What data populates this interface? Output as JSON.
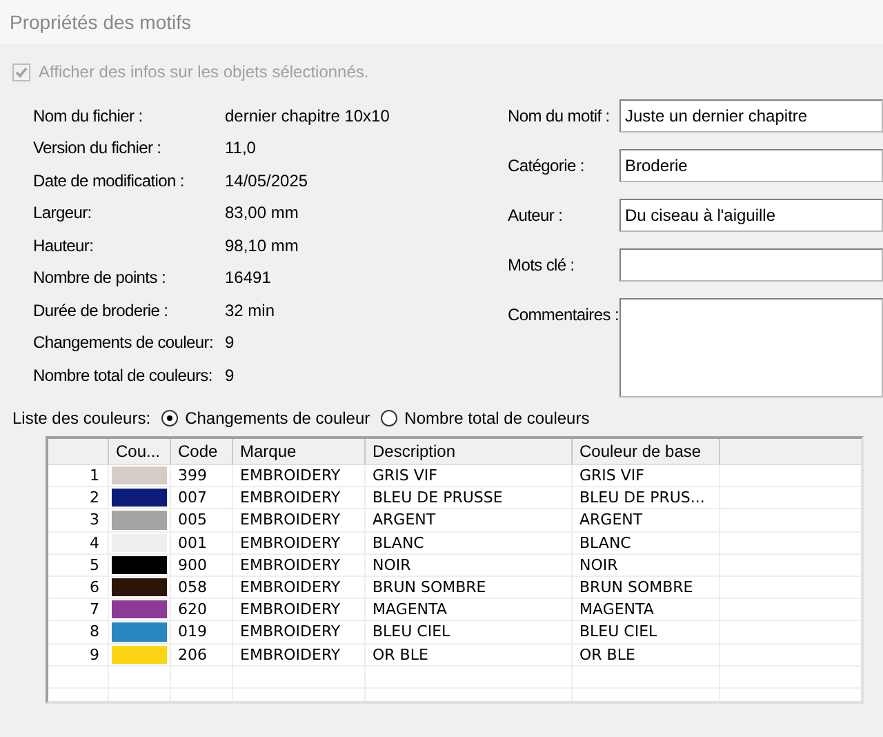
{
  "window": {
    "title": "Propriétés des motifs"
  },
  "show_info": {
    "label": "Afficher des infos sur les objets sélectionnés.",
    "checked": true,
    "disabled": true
  },
  "info": [
    {
      "label": "Nom du fichier :",
      "value": "dernier chapitre 10x10"
    },
    {
      "label": "Version du fichier :",
      "value": "11,0"
    },
    {
      "label": "Date de modification :",
      "value": "14/05/2025"
    },
    {
      "label": "Largeur:",
      "value": "83,00 mm"
    },
    {
      "label": "Hauteur:",
      "value": "98,10 mm"
    },
    {
      "label": "Nombre de points :",
      "value": "16491"
    },
    {
      "label": "Durée de broderie :",
      "value": "32 min"
    },
    {
      "label": "Changements de couleur:",
      "value": "9"
    },
    {
      "label": "Nombre total de couleurs:",
      "value": "9"
    }
  ],
  "fields": [
    {
      "label": "Nom du motif :",
      "value": "Juste un dernier chapitre",
      "kind": "line"
    },
    {
      "label": "Catégorie :",
      "value": "Broderie",
      "kind": "line"
    },
    {
      "label": "Auteur :",
      "value": "Du ciseau à l'aiguille",
      "kind": "line"
    },
    {
      "label": "Mots clé :",
      "kind": "line"
    },
    {
      "label": "Commentaires :",
      "kind": "area"
    }
  ],
  "color_list": {
    "label": "Liste des couleurs:",
    "options": [
      {
        "label": "Changements de couleur",
        "selected": true
      },
      {
        "label": "Nombre total de couleurs",
        "selected": false
      }
    ]
  },
  "table": {
    "columns": [
      "Cou...",
      "Code",
      "Marque",
      "Description",
      "Couleur de base"
    ],
    "rows": [
      {
        "index": "1",
        "color": "#d5ccc7",
        "code": "399",
        "brand": "EMBROIDERY",
        "description": "GRIS VIF",
        "base": "GRIS VIF"
      },
      {
        "index": "2",
        "color": "#0c1c78",
        "code": "007",
        "brand": "EMBROIDERY",
        "description": "BLEU DE PRUSSE",
        "base": "BLEU DE PRUS..."
      },
      {
        "index": "3",
        "color": "#a5a5a5",
        "code": "005",
        "brand": "EMBROIDERY",
        "description": "ARGENT",
        "base": "ARGENT"
      },
      {
        "index": "4",
        "color": "#eeeeee",
        "code": "001",
        "brand": "EMBROIDERY",
        "description": "BLANC",
        "base": "BLANC"
      },
      {
        "index": "5",
        "color": "#000000",
        "code": "900",
        "brand": "EMBROIDERY",
        "description": "NOIR",
        "base": "NOIR"
      },
      {
        "index": "6",
        "color": "#2e1408",
        "code": "058",
        "brand": "EMBROIDERY",
        "description": "BRUN SOMBRE",
        "base": "BRUN SOMBRE"
      },
      {
        "index": "7",
        "color": "#8c3a96",
        "code": "620",
        "brand": "EMBROIDERY",
        "description": "MAGENTA",
        "base": "MAGENTA"
      },
      {
        "index": "8",
        "color": "#2a88c0",
        "code": "019",
        "brand": "EMBROIDERY",
        "description": "BLEU CIEL",
        "base": "BLEU CIEL"
      },
      {
        "index": "9",
        "color": "#fcd615",
        "code": "206",
        "brand": "EMBROIDERY",
        "description": "OR BLE",
        "base": "OR BLE"
      }
    ]
  }
}
